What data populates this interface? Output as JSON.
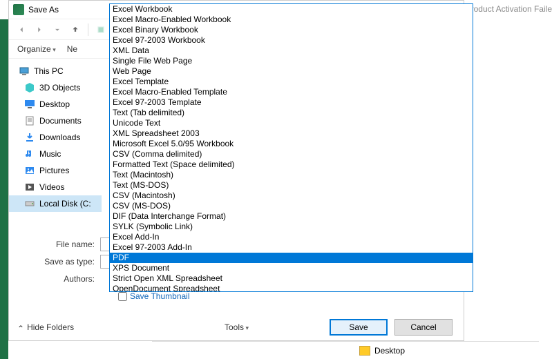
{
  "header": {
    "activation": "Product Activation Faile"
  },
  "dialog": {
    "title": "Save As",
    "toolbar": {
      "organize": "Organize",
      "new": "Ne"
    },
    "nav": {
      "root": "This PC",
      "items": [
        {
          "label": "3D Objects",
          "icon": "cube"
        },
        {
          "label": "Desktop",
          "icon": "desktop"
        },
        {
          "label": "Documents",
          "icon": "documents"
        },
        {
          "label": "Downloads",
          "icon": "downloads"
        },
        {
          "label": "Music",
          "icon": "music"
        },
        {
          "label": "Pictures",
          "icon": "pictures"
        },
        {
          "label": "Videos",
          "icon": "videos"
        },
        {
          "label": "Local Disk (C:",
          "icon": "disk",
          "selected": true
        }
      ]
    },
    "form": {
      "filename_label": "File name:",
      "type_label": "Save as type:",
      "authors_label": "Authors:",
      "save_thumbnail": "Save Thumbnail"
    },
    "buttons": {
      "tools": "Tools",
      "save": "Save",
      "cancel": "Cancel",
      "hide": "Hide Folders"
    }
  },
  "dropdown": {
    "selected": "PDF",
    "options": [
      "Excel Workbook",
      "Excel Macro-Enabled Workbook",
      "Excel Binary Workbook",
      "Excel 97-2003 Workbook",
      "XML Data",
      "Single File Web Page",
      "Web Page",
      "Excel Template",
      "Excel Macro-Enabled Template",
      "Excel 97-2003 Template",
      "Text (Tab delimited)",
      "Unicode Text",
      "XML Spreadsheet 2003",
      "Microsoft Excel 5.0/95 Workbook",
      "CSV (Comma delimited)",
      "Formatted Text (Space delimited)",
      "Text (Macintosh)",
      "Text (MS-DOS)",
      "CSV (Macintosh)",
      "CSV (MS-DOS)",
      "DIF (Data Interchange Format)",
      "SYLK (Symbolic Link)",
      "Excel Add-In",
      "Excel 97-2003 Add-In",
      "PDF",
      "XPS Document",
      "Strict Open XML Spreadsheet",
      "OpenDocument Spreadsheet"
    ]
  },
  "desktop_label": "Desktop"
}
